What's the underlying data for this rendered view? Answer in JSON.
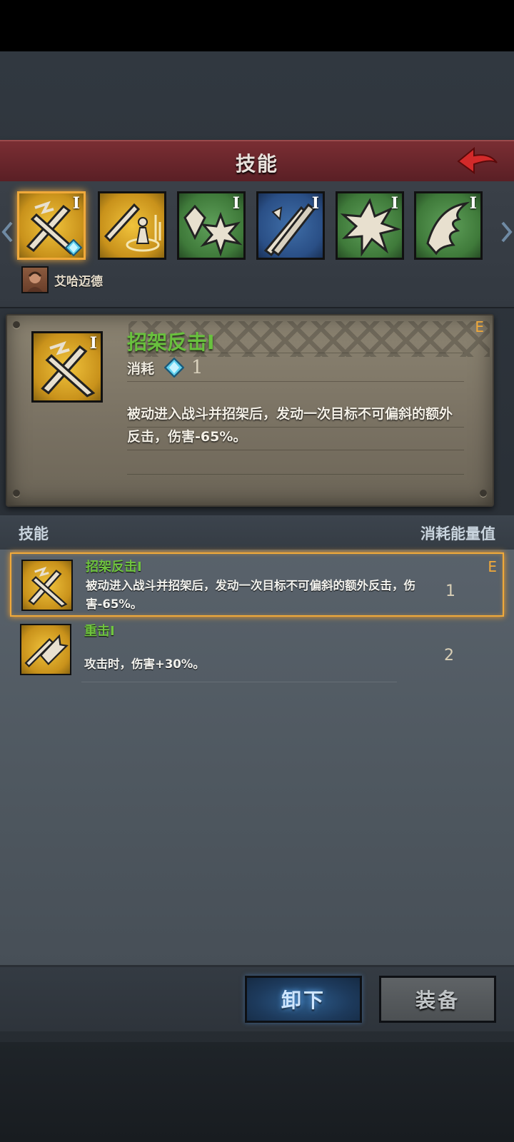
{
  "header": {
    "title": "技能"
  },
  "icon_strip": {
    "tiles": [
      {
        "rank": "I",
        "icon": "parry-counter-icon",
        "theme": "gold",
        "selected": true
      },
      {
        "rank": "",
        "icon": "sword-aura-icon",
        "theme": "gold",
        "selected": false
      },
      {
        "rank": "I",
        "icon": "crystal-burst-icon",
        "theme": "green",
        "selected": false
      },
      {
        "rank": "I",
        "icon": "crossed-swords-icon",
        "theme": "blue",
        "selected": false
      },
      {
        "rank": "I",
        "icon": "burst-icon",
        "theme": "green",
        "selected": false
      },
      {
        "rank": "I",
        "icon": "claw-icon",
        "theme": "green",
        "selected": false
      }
    ],
    "hero_name": "艾哈迈德"
  },
  "detail": {
    "title": "招架反击I",
    "grade": "E",
    "cost_label": "消耗",
    "cost_value": "1",
    "rank": "I",
    "description": "被动进入战斗并招架后，发动一次目标不可偏斜的额外反击，伤害-65%。"
  },
  "list": {
    "col_skill": "技能",
    "col_cost": "消耗能量值",
    "rows": [
      {
        "name": "招架反击I",
        "description": "被动进入战斗并招架后，发动一次目标不可偏斜的额外反击，伤害-65%。",
        "cost": "1",
        "grade": "E",
        "selected": true
      },
      {
        "name": "重击I",
        "description": "攻击时，伤害+30%。",
        "cost": "2",
        "grade": "",
        "selected": false
      }
    ]
  },
  "buttons": {
    "unequip": "卸下",
    "equip": "装备"
  },
  "colors": {
    "skill_name": "#69c13e",
    "selection": "#f0a93a",
    "header": "#6b262c"
  }
}
